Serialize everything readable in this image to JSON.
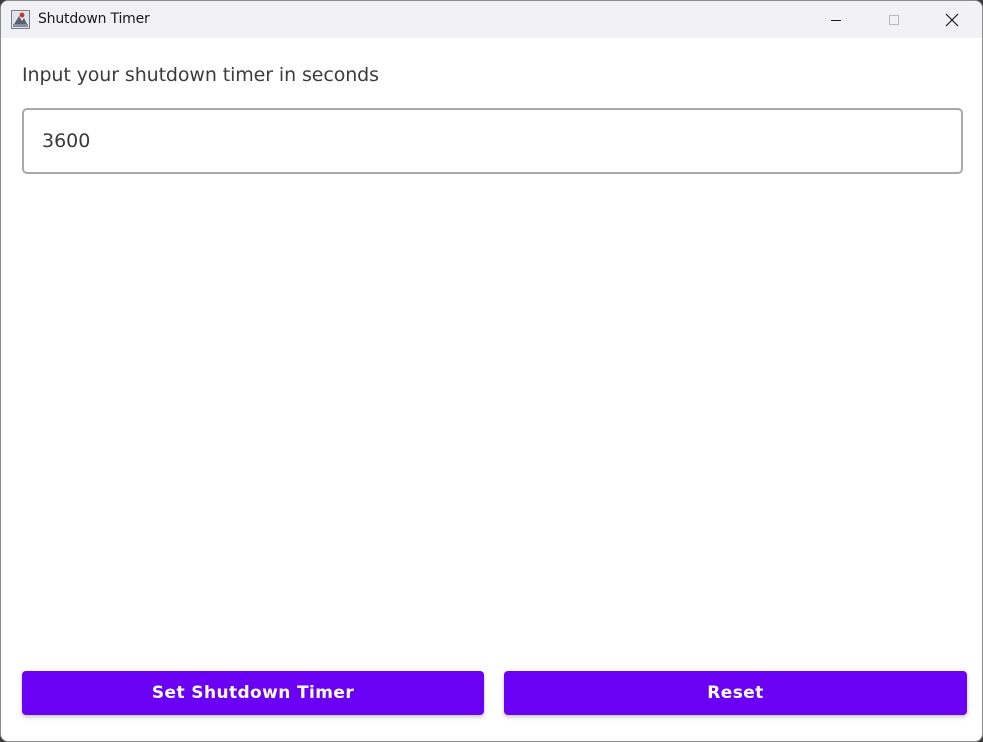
{
  "window": {
    "title": "Shutdown Timer"
  },
  "titlebar_buttons": {
    "minimize": "minimize-icon",
    "maximize": "maximize-icon",
    "close": "close-icon"
  },
  "main": {
    "prompt": "Input your shutdown timer in seconds",
    "timer_input_value": "3600"
  },
  "actions": {
    "set_label": "Set Shutdown Timer",
    "reset_label": "Reset"
  },
  "colors": {
    "accent": "#6a00f4",
    "titlebar": "#f1f1f6"
  }
}
